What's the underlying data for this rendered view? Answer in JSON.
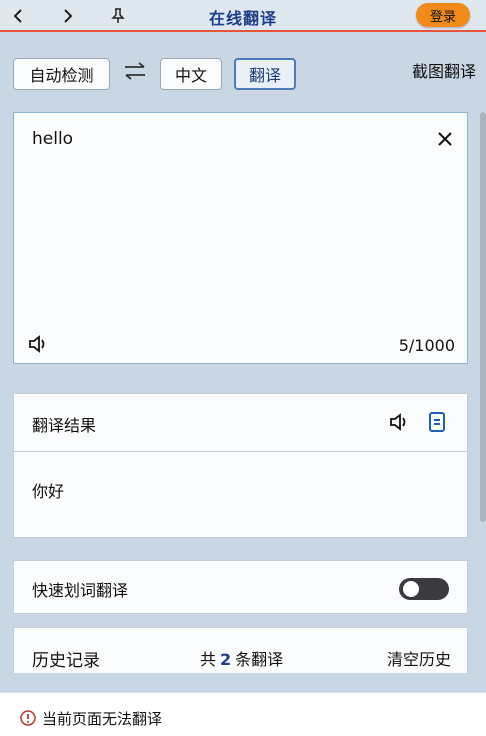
{
  "titlebar": {
    "title": "在线翻译",
    "login_label": "登录",
    "icons": [
      "back-icon",
      "forward-icon",
      "pin-icon"
    ]
  },
  "lang": {
    "source_label": "自动检测",
    "target_label": "中文",
    "translate_label": "翻译",
    "screenshot_label": "截图翻译",
    "swap_icon": "swap-icon"
  },
  "input": {
    "text": "hello",
    "counter": "5/1000"
  },
  "result": {
    "title": "翻译结果",
    "text": "你好"
  },
  "quick": {
    "label": "快速划词翻译",
    "enabled": false
  },
  "history": {
    "label": "历史记录",
    "count_prefix": "共",
    "count": "2",
    "count_suffix": "条翻译",
    "clear_label": "清空历史"
  },
  "footer": {
    "warning": "当前页面无法翻译"
  },
  "colors": {
    "accent": "#1f3f8a",
    "login": "#f08a1a",
    "titlebar_line": "#e4553a",
    "background": "#c9d6e3"
  }
}
